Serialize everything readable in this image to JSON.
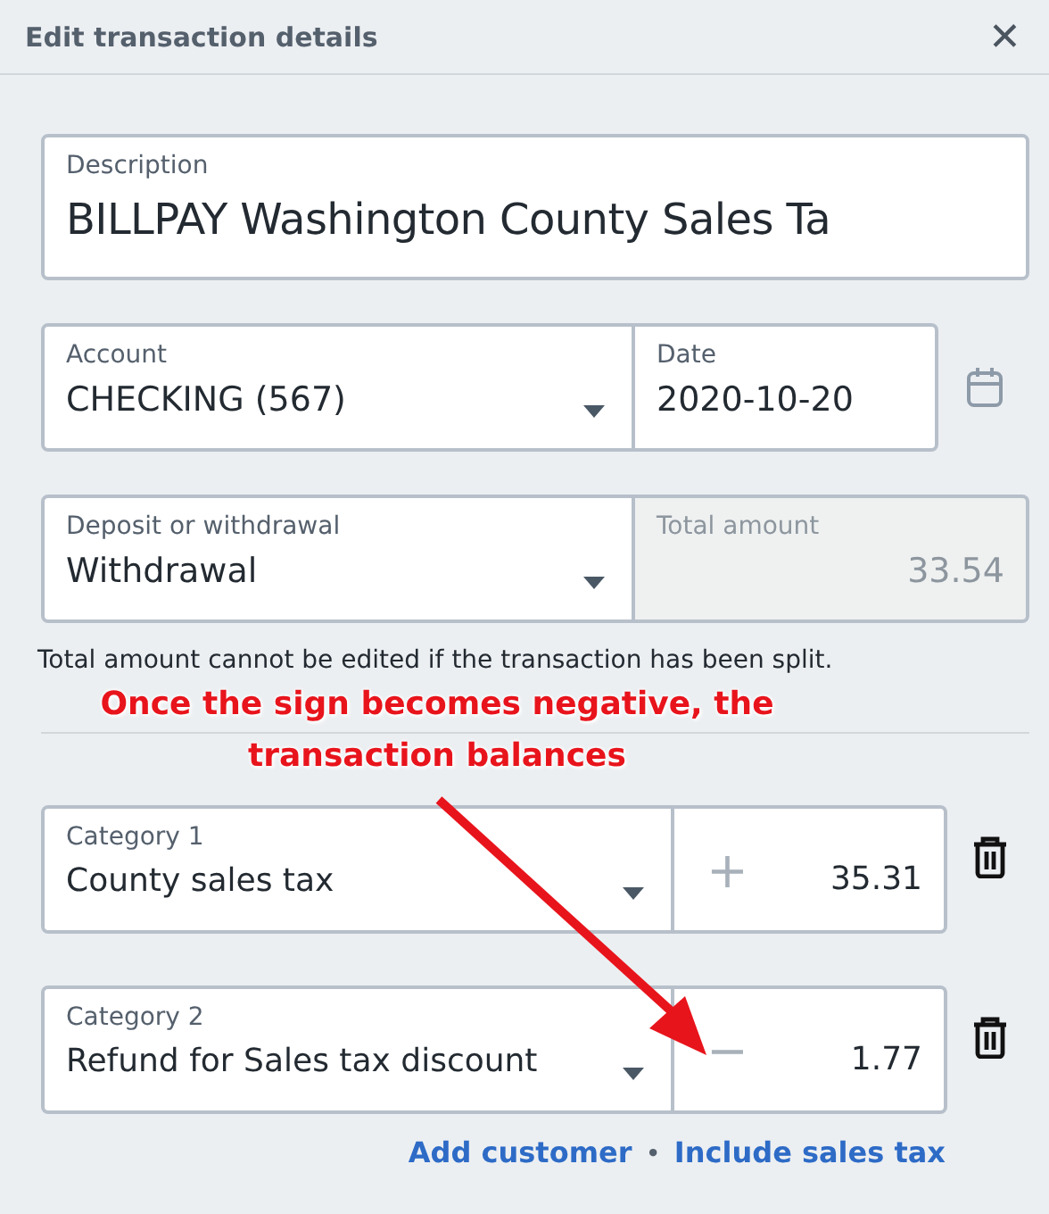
{
  "dialog": {
    "title": "Edit transaction details",
    "close": "✕"
  },
  "description": {
    "label": "Description",
    "value": "BILLPAY Washington County Sales Ta"
  },
  "account": {
    "label": "Account",
    "value": "CHECKING (567)"
  },
  "date": {
    "label": "Date",
    "value": "2020-10-20"
  },
  "type": {
    "label": "Deposit or withdrawal",
    "value": "Withdrawal"
  },
  "total": {
    "label": "Total amount",
    "value": "33.54",
    "disabled": true
  },
  "note": "Total amount cannot be edited if the transaction has been split.",
  "annotation": {
    "lines": [
      "Once the sign becomes negative, the",
      "transaction balances"
    ]
  },
  "categories": [
    {
      "label": "Category 1",
      "value": "County sales tax",
      "sign": "+",
      "amount": "35.31"
    },
    {
      "label": "Category 2",
      "value": "Refund for Sales tax discount",
      "sign": "−",
      "amount": "1.77"
    }
  ],
  "links": [
    "Add customer",
    "Include sales tax"
  ],
  "link_separator": "•"
}
